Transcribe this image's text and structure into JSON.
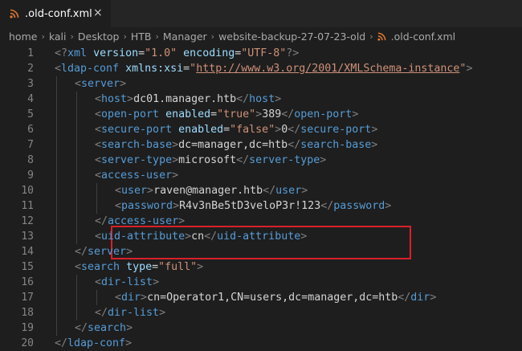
{
  "tab": {
    "filename": ".old-conf.xml",
    "icon": "rss-icon",
    "close_glyph": "×"
  },
  "breadcrumb": {
    "items": [
      "home",
      "kali",
      "Desktop",
      "HTB",
      "Manager",
      "website-backup-27-07-23-old"
    ],
    "file": ".old-conf.xml",
    "separator": "›"
  },
  "colors": {
    "tag": "#569cd6",
    "attribute": "#9cdcfe",
    "string": "#ce9178",
    "text": "#d4d4d4",
    "line_number": "#858585",
    "highlight_border": "#d9202a",
    "file_icon": "#e37933"
  },
  "editor": {
    "lines": [
      {
        "n": "1",
        "indent": 0,
        "tokens": [
          [
            "b",
            "<?"
          ],
          [
            "tag",
            "xml"
          ],
          [
            "t",
            " "
          ],
          [
            "attr",
            "version"
          ],
          [
            "eq",
            "="
          ],
          [
            "str",
            "\"1.0\""
          ],
          [
            "t",
            " "
          ],
          [
            "attr",
            "encoding"
          ],
          [
            "eq",
            "="
          ],
          [
            "str",
            "\"UTF-8\""
          ],
          [
            "b",
            "?>"
          ]
        ]
      },
      {
        "n": "2",
        "indent": 0,
        "tokens": [
          [
            "b",
            "<"
          ],
          [
            "tag",
            "ldap-conf"
          ],
          [
            "t",
            " "
          ],
          [
            "attr",
            "xmlns:xsi"
          ],
          [
            "eq",
            "="
          ],
          [
            "str",
            "\""
          ],
          [
            "url",
            "http://www.w3.org/2001/XMLSchema-instance"
          ],
          [
            "str",
            "\""
          ],
          [
            "b",
            ">"
          ]
        ]
      },
      {
        "n": "3",
        "indent": 1,
        "tokens": [
          [
            "b",
            "<"
          ],
          [
            "tag",
            "server"
          ],
          [
            "b",
            ">"
          ]
        ]
      },
      {
        "n": "4",
        "indent": 2,
        "tokens": [
          [
            "b",
            "<"
          ],
          [
            "tag",
            "host"
          ],
          [
            "b",
            ">"
          ],
          [
            "t",
            "dc01.manager.htb"
          ],
          [
            "b",
            "</"
          ],
          [
            "tag",
            "host"
          ],
          [
            "b",
            ">"
          ]
        ]
      },
      {
        "n": "5",
        "indent": 2,
        "tokens": [
          [
            "b",
            "<"
          ],
          [
            "tag",
            "open-port"
          ],
          [
            "t",
            " "
          ],
          [
            "attr",
            "enabled"
          ],
          [
            "eq",
            "="
          ],
          [
            "str",
            "\"true\""
          ],
          [
            "b",
            ">"
          ],
          [
            "t",
            "389"
          ],
          [
            "b",
            "</"
          ],
          [
            "tag",
            "open-port"
          ],
          [
            "b",
            ">"
          ]
        ]
      },
      {
        "n": "6",
        "indent": 2,
        "tokens": [
          [
            "b",
            "<"
          ],
          [
            "tag",
            "secure-port"
          ],
          [
            "t",
            " "
          ],
          [
            "attr",
            "enabled"
          ],
          [
            "eq",
            "="
          ],
          [
            "str",
            "\"false\""
          ],
          [
            "b",
            ">"
          ],
          [
            "t",
            "0"
          ],
          [
            "b",
            "</"
          ],
          [
            "tag",
            "secure-port"
          ],
          [
            "b",
            ">"
          ]
        ]
      },
      {
        "n": "7",
        "indent": 2,
        "tokens": [
          [
            "b",
            "<"
          ],
          [
            "tag",
            "search-base"
          ],
          [
            "b",
            ">"
          ],
          [
            "t",
            "dc=manager,dc=htb"
          ],
          [
            "b",
            "</"
          ],
          [
            "tag",
            "search-base"
          ],
          [
            "b",
            ">"
          ]
        ]
      },
      {
        "n": "8",
        "indent": 2,
        "tokens": [
          [
            "b",
            "<"
          ],
          [
            "tag",
            "server-type"
          ],
          [
            "b",
            ">"
          ],
          [
            "t",
            "microsoft"
          ],
          [
            "b",
            "</"
          ],
          [
            "tag",
            "server-type"
          ],
          [
            "b",
            ">"
          ]
        ]
      },
      {
        "n": "9",
        "indent": 2,
        "tokens": [
          [
            "b",
            "<"
          ],
          [
            "tag",
            "access-user"
          ],
          [
            "b",
            ">"
          ]
        ]
      },
      {
        "n": "10",
        "indent": 3,
        "tokens": [
          [
            "b",
            "<"
          ],
          [
            "tag",
            "user"
          ],
          [
            "b",
            ">"
          ],
          [
            "t",
            "raven@manager.htb"
          ],
          [
            "b",
            "</"
          ],
          [
            "tag",
            "user"
          ],
          [
            "b",
            ">"
          ]
        ]
      },
      {
        "n": "11",
        "indent": 3,
        "tokens": [
          [
            "b",
            "<"
          ],
          [
            "tag",
            "password"
          ],
          [
            "b",
            ">"
          ],
          [
            "t",
            "R4v3nBe5tD3veloP3r!123"
          ],
          [
            "b",
            "</"
          ],
          [
            "tag",
            "password"
          ],
          [
            "b",
            ">"
          ]
        ]
      },
      {
        "n": "12",
        "indent": 2,
        "tokens": [
          [
            "b",
            "</"
          ],
          [
            "tag",
            "access-user"
          ],
          [
            "b",
            ">"
          ]
        ]
      },
      {
        "n": "13",
        "indent": 2,
        "tokens": [
          [
            "b",
            "<"
          ],
          [
            "tag",
            "uid-attribute"
          ],
          [
            "b",
            ">"
          ],
          [
            "t",
            "cn"
          ],
          [
            "b",
            "</"
          ],
          [
            "tag",
            "uid-attribute"
          ],
          [
            "b",
            ">"
          ]
        ]
      },
      {
        "n": "14",
        "indent": 1,
        "tokens": [
          [
            "b",
            "</"
          ],
          [
            "tag",
            "server"
          ],
          [
            "b",
            ">"
          ]
        ]
      },
      {
        "n": "15",
        "indent": 1,
        "tokens": [
          [
            "b",
            "<"
          ],
          [
            "tag",
            "search"
          ],
          [
            "t",
            " "
          ],
          [
            "attr",
            "type"
          ],
          [
            "eq",
            "="
          ],
          [
            "str",
            "\"full\""
          ],
          [
            "b",
            ">"
          ]
        ]
      },
      {
        "n": "16",
        "indent": 2,
        "tokens": [
          [
            "b",
            "<"
          ],
          [
            "tag",
            "dir-list"
          ],
          [
            "b",
            ">"
          ]
        ]
      },
      {
        "n": "17",
        "indent": 3,
        "tokens": [
          [
            "b",
            "<"
          ],
          [
            "tag",
            "dir"
          ],
          [
            "b",
            ">"
          ],
          [
            "t",
            "cn=Operator1,CN=users,dc=manager,dc=htb"
          ],
          [
            "b",
            "</"
          ],
          [
            "tag",
            "dir"
          ],
          [
            "b",
            ">"
          ]
        ]
      },
      {
        "n": "18",
        "indent": 2,
        "tokens": [
          [
            "b",
            "</"
          ],
          [
            "tag",
            "dir-list"
          ],
          [
            "b",
            ">"
          ]
        ]
      },
      {
        "n": "19",
        "indent": 1,
        "tokens": [
          [
            "b",
            "</"
          ],
          [
            "tag",
            "search"
          ],
          [
            "b",
            ">"
          ]
        ]
      },
      {
        "n": "20",
        "indent": 0,
        "tokens": [
          [
            "b",
            "</"
          ],
          [
            "tag",
            "ldap-conf"
          ],
          [
            "b",
            ">"
          ]
        ]
      }
    ],
    "highlighted_lines": [
      "10",
      "11"
    ]
  }
}
